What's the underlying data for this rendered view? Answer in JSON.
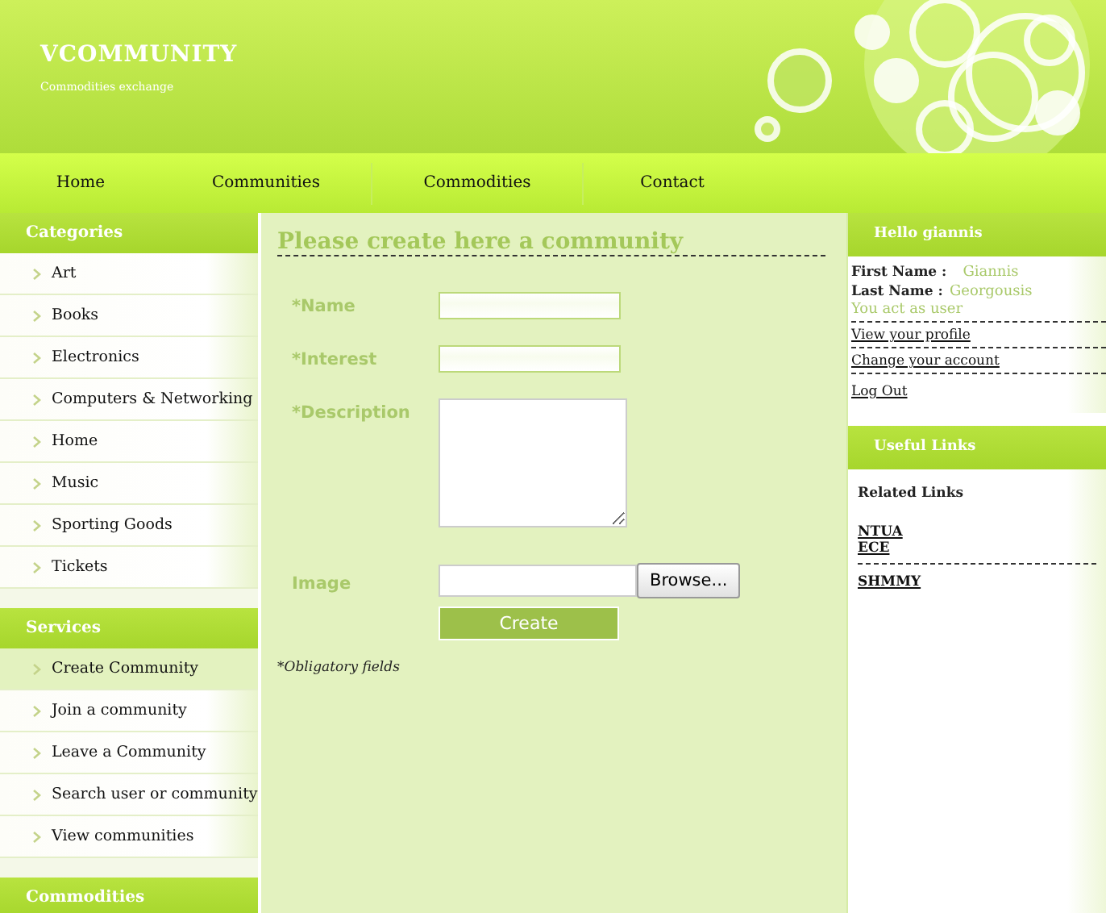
{
  "header": {
    "title": "VCOMMUNITY",
    "subtitle": "Commodities exchange"
  },
  "nav": [
    {
      "label": "Home"
    },
    {
      "label": "Communities"
    },
    {
      "label": "Commodities"
    },
    {
      "label": "Contact"
    }
  ],
  "sidebar": {
    "sections": [
      {
        "title": "Categories",
        "items": [
          {
            "label": "Art",
            "selected": false
          },
          {
            "label": "Books",
            "selected": false
          },
          {
            "label": "Electronics",
            "selected": false
          },
          {
            "label": "Computers & Networking",
            "selected": false
          },
          {
            "label": "Home",
            "selected": false
          },
          {
            "label": "Music",
            "selected": false
          },
          {
            "label": "Sporting Goods",
            "selected": false
          },
          {
            "label": "Tickets",
            "selected": false
          }
        ]
      },
      {
        "title": "Services",
        "items": [
          {
            "label": "Create Community",
            "selected": true
          },
          {
            "label": "Join a community",
            "selected": false
          },
          {
            "label": "Leave a Community",
            "selected": false
          },
          {
            "label": "Search user or community",
            "selected": false
          },
          {
            "label": "View communities",
            "selected": false
          }
        ]
      },
      {
        "title": "Commodities"
      }
    ]
  },
  "form": {
    "title": "Please create here a community",
    "fields": [
      {
        "kind": "text",
        "label": "*Name"
      },
      {
        "kind": "text",
        "label": "*Interest"
      },
      {
        "kind": "textarea",
        "label": "*Description"
      },
      {
        "kind": "file",
        "label": "Image",
        "button": "Browse..."
      }
    ],
    "submit": "Create",
    "note": "*Obligatory fields"
  },
  "user_panel": {
    "title": "Hello giannis",
    "first_name_label": "First Name :",
    "first_name": "Giannis",
    "last_name_label": "Last Name :",
    "last_name": "Georgousis",
    "role": "You act as user",
    "links": [
      "View your profile",
      "Change your account",
      "Log Out"
    ]
  },
  "useful_links": {
    "title": "Useful Links",
    "heading": "Related Links",
    "links": [
      {
        "label": "NTUA",
        "divider_after": false
      },
      {
        "label": "ECE",
        "divider_after": true
      },
      {
        "label": "SHMMY",
        "divider_after": false
      }
    ]
  }
}
